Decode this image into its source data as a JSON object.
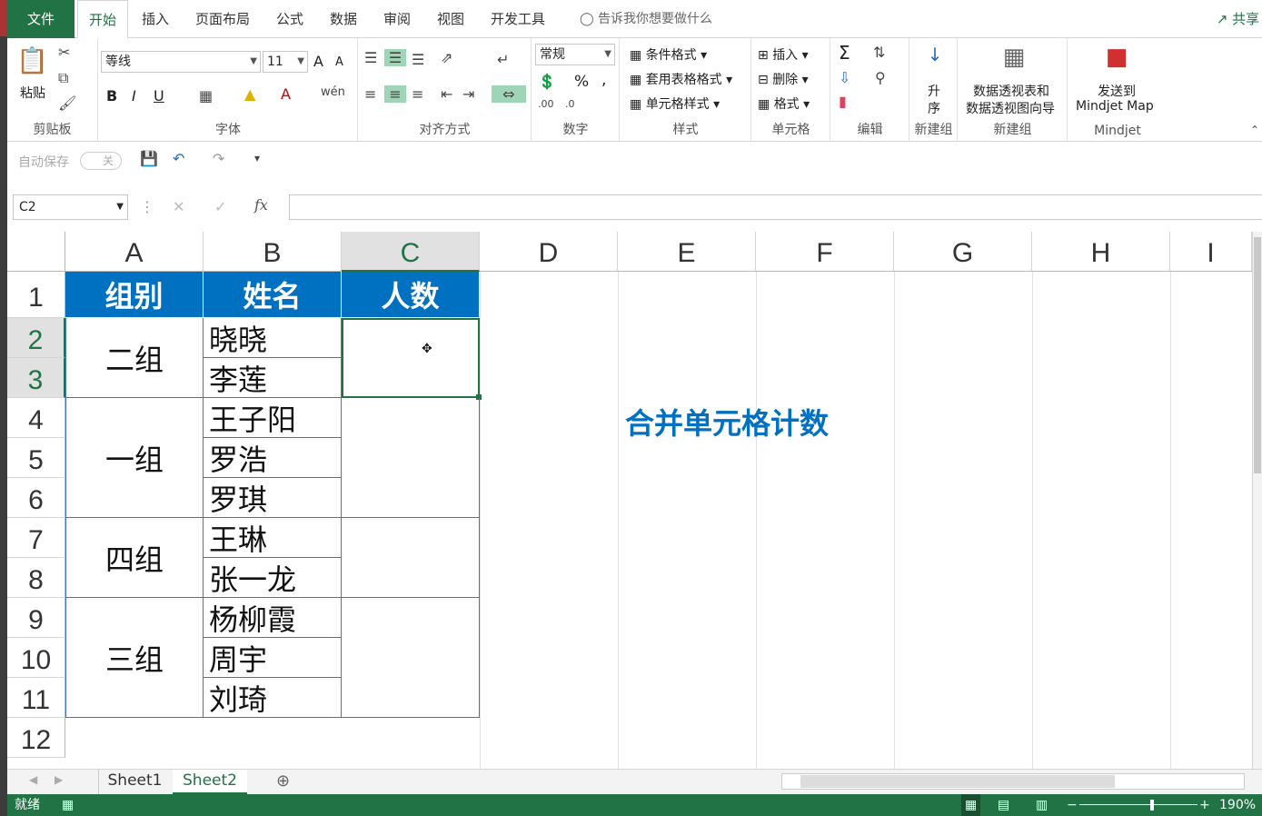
{
  "tabs": [
    "文件",
    "开始",
    "插入",
    "页面布局",
    "公式",
    "数据",
    "审阅",
    "视图",
    "开发工具"
  ],
  "tell_me": "告诉我你想要做什么",
  "share": "共享",
  "ribbon": {
    "clipboard": {
      "paste": "粘贴",
      "label": "剪贴板"
    },
    "font": {
      "name": "等线",
      "size": "11",
      "label": "字体",
      "bold": "B",
      "italic": "I",
      "underline": "U",
      "inc": "A",
      "dec": "A"
    },
    "align": {
      "label": "对齐方式"
    },
    "number": {
      "format": "常规",
      "label": "数字",
      "percent": "%",
      "comma": ","
    },
    "styles": {
      "cond": "条件格式",
      "table": "套用表格格式",
      "cell": "单元格样式",
      "label": "样式"
    },
    "cells": {
      "insert": "插入",
      "delete": "删除",
      "format": "格式",
      "label": "单元格"
    },
    "edit": {
      "label": "编辑",
      "sum": "Σ"
    },
    "sort": {
      "name1": "升",
      "name2": "序",
      "label": "新建组"
    },
    "pivot": {
      "line1": "数据透视表和",
      "line2": "数据透视图向导",
      "label": "新建组"
    },
    "mindjet": {
      "line1": "发送到",
      "line2": "Mindjet Map",
      "label": "Mindjet"
    }
  },
  "qat": {
    "autosave": "自动保存",
    "toggle": "关"
  },
  "formula": {
    "namebox": "C2",
    "fx": "fx",
    "content": ""
  },
  "columns": [
    "A",
    "B",
    "C",
    "D",
    "E",
    "F",
    "G",
    "H",
    "I"
  ],
  "rows": [
    "1",
    "2",
    "3",
    "4",
    "5",
    "6",
    "7",
    "8",
    "9",
    "10",
    "11",
    "12"
  ],
  "table": {
    "headers": [
      "组别",
      "姓名",
      "人数"
    ],
    "groups": [
      {
        "name": "二组",
        "members": [
          "晓晓",
          "李莲"
        ]
      },
      {
        "name": "一组",
        "members": [
          "王子阳",
          "罗浩",
          "罗琪"
        ]
      },
      {
        "name": "四组",
        "members": [
          "王琳",
          "张一龙"
        ]
      },
      {
        "name": "三组",
        "members": [
          "杨柳霞",
          "周宇",
          "刘琦"
        ]
      }
    ]
  },
  "annotation": "合并单元格计数",
  "sheets": [
    "Sheet1",
    "Sheet2"
  ],
  "status": {
    "ready": "就绪",
    "zoom": "190%"
  },
  "colors": {
    "excel_green": "#217346",
    "header_blue": "#0070c0",
    "annotation_blue": "#0070c0"
  }
}
